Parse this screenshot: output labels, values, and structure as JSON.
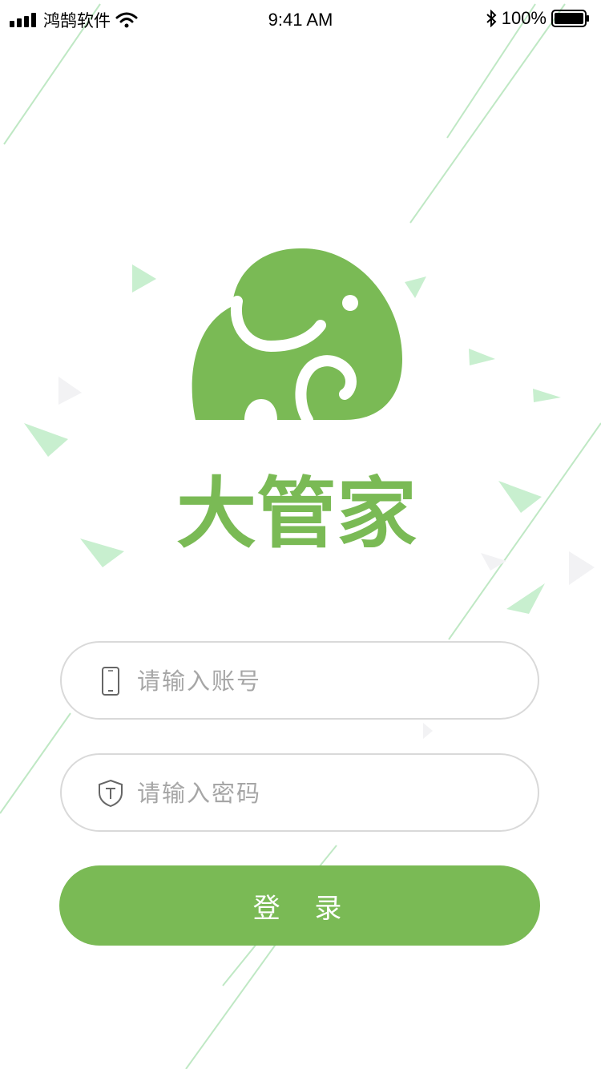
{
  "status_bar": {
    "carrier": "鸿鹄软件",
    "time": "9:41 AM",
    "battery": "100%"
  },
  "brand": {
    "name": "大管家"
  },
  "login_form": {
    "account_placeholder": "请输入账号",
    "password_placeholder": "请输入密码",
    "account_value": "",
    "password_value": "",
    "submit_label": "登 录"
  },
  "colors": {
    "brand_green": "#7aba55",
    "input_border": "#d9d9d9",
    "placeholder": "#a6a6a6",
    "decoration_green": "#bfe8c4"
  },
  "icons": {
    "account_field": "phone-icon",
    "password_field": "shield-icon"
  }
}
